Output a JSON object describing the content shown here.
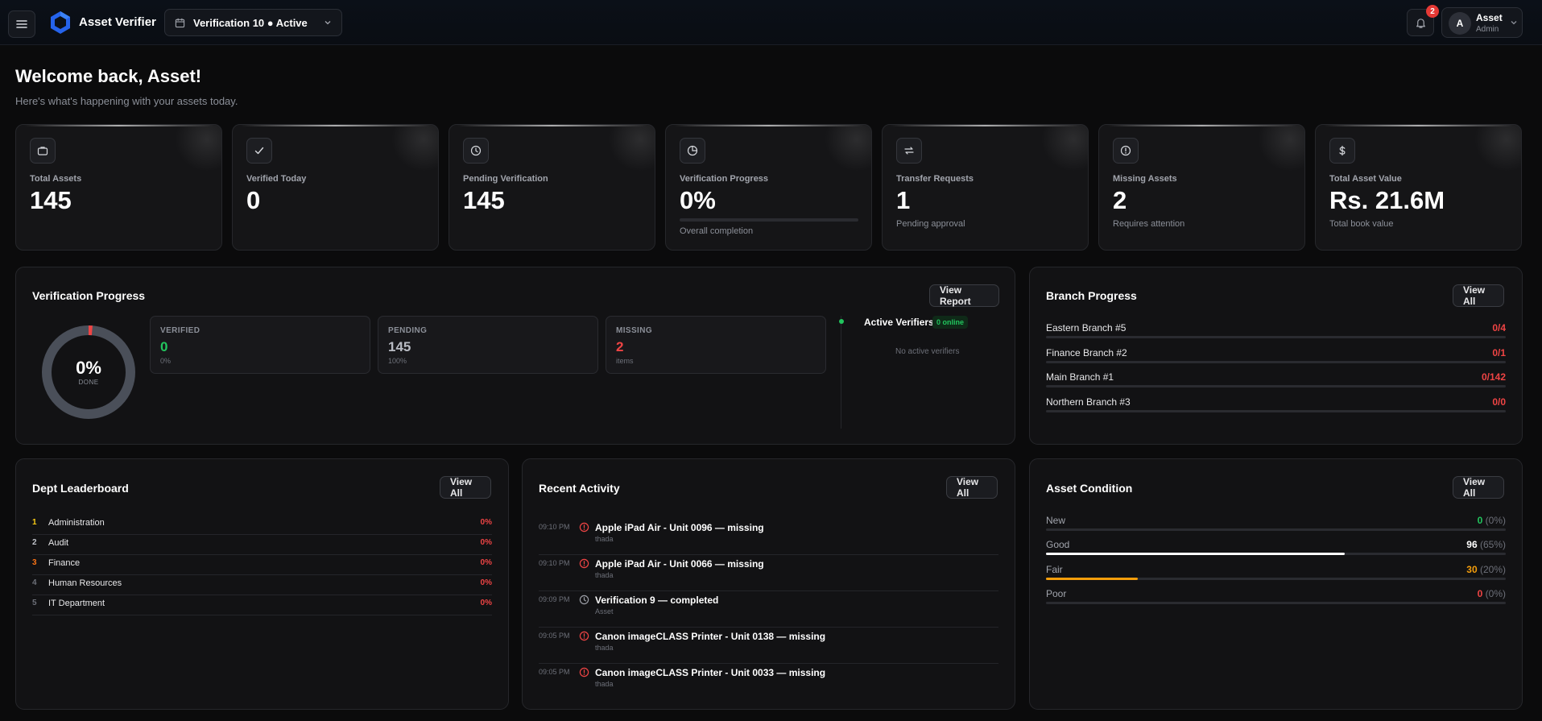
{
  "header": {
    "app_name": "Asset Verifier",
    "verification_selector": "Verification 10 ● Active",
    "notification_count": "2",
    "user": {
      "initial": "A",
      "name": "Asset",
      "role": "Admin"
    }
  },
  "welcome": {
    "title": "Welcome back, Asset!",
    "subtitle": "Here's what's happening with your assets today."
  },
  "stats": [
    {
      "icon": "briefcase-icon",
      "label": "Total Assets",
      "value": "145",
      "sub": ""
    },
    {
      "icon": "check-icon",
      "label": "Verified Today",
      "value": "0",
      "sub": ""
    },
    {
      "icon": "clock-icon",
      "label": "Pending Verification",
      "value": "145",
      "sub": ""
    },
    {
      "icon": "pie-chart-icon",
      "label": "Verification Progress",
      "value": "0%",
      "sub": "Overall completion",
      "progress": 0
    },
    {
      "icon": "transfer-icon",
      "label": "Transfer Requests",
      "value": "1",
      "sub": "Pending approval"
    },
    {
      "icon": "alert-circle-icon",
      "label": "Missing Assets",
      "value": "2",
      "sub": "Requires attention"
    },
    {
      "icon": "dollar-icon",
      "label": "Total Asset Value",
      "value": "Rs. 21.6M",
      "sub": "Total book value"
    }
  ],
  "verification_progress": {
    "title": "Verification Progress",
    "button": "View Report",
    "donut": {
      "percent_label": "0%",
      "caption": "DONE",
      "missing_fraction": 0.0138
    },
    "cards": [
      {
        "label": "VERIFIED",
        "value": "0",
        "sub": "0%",
        "color": "#22c55e"
      },
      {
        "label": "PENDING",
        "value": "145",
        "sub": "100%",
        "color": "#b8bbc3"
      },
      {
        "label": "MISSING",
        "value": "2",
        "sub": "items",
        "color": "#ef4444"
      }
    ],
    "active_verifiers": {
      "title": "Active Verifiers",
      "badge": "0 online",
      "empty": "No active verifiers"
    }
  },
  "branch_progress": {
    "title": "Branch Progress",
    "button": "View All",
    "rows": [
      {
        "name": "Eastern Branch #5",
        "value": "0/4",
        "progress": 0
      },
      {
        "name": "Finance Branch #2",
        "value": "0/1",
        "progress": 0
      },
      {
        "name": "Main Branch #1",
        "value": "0/142",
        "progress": 0
      },
      {
        "name": "Northern Branch #3",
        "value": "0/0",
        "progress": 0
      }
    ]
  },
  "leaderboard": {
    "title": "Dept Leaderboard",
    "button": "View All",
    "rows": [
      {
        "rank": "1",
        "dept": "Administration",
        "pct": "0%",
        "rank_color": "#facc15"
      },
      {
        "rank": "2",
        "dept": "Audit",
        "pct": "0%",
        "rank_color": "#c0c3ca"
      },
      {
        "rank": "3",
        "dept": "Finance",
        "pct": "0%",
        "rank_color": "#f97316"
      },
      {
        "rank": "4",
        "dept": "Human Resources",
        "pct": "0%",
        "rank_color": "#6d7079"
      },
      {
        "rank": "5",
        "dept": "IT Department",
        "pct": "0%",
        "rank_color": "#6d7079"
      }
    ]
  },
  "activity": {
    "title": "Recent Activity",
    "button": "View All",
    "rows": [
      {
        "time": "09:10 PM",
        "icon": "alert-circle-icon",
        "title": "Apple iPad Air - Unit 0096 — missing",
        "who": "thada",
        "icon_color": "#ef4444"
      },
      {
        "time": "09:10 PM",
        "icon": "alert-circle-icon",
        "title": "Apple iPad Air - Unit 0066 — missing",
        "who": "thada",
        "icon_color": "#ef4444"
      },
      {
        "time": "09:09 PM",
        "icon": "clock-icon",
        "title": "Verification 9 — completed",
        "who": "Asset",
        "icon_color": "#9a9da5"
      },
      {
        "time": "09:05 PM",
        "icon": "alert-circle-icon",
        "title": "Canon imageCLASS Printer - Unit 0138 — missing",
        "who": "thada",
        "icon_color": "#ef4444"
      },
      {
        "time": "09:05 PM",
        "icon": "alert-circle-icon",
        "title": "Canon imageCLASS Printer - Unit 0033 — missing",
        "who": "thada",
        "icon_color": "#ef4444"
      }
    ]
  },
  "asset_condition": {
    "title": "Asset Condition",
    "button": "View All",
    "rows": [
      {
        "name": "New",
        "count": "0",
        "pct": "(0%)",
        "progress": 0,
        "color": "#22c55e"
      },
      {
        "name": "Good",
        "count": "96",
        "pct": "(65%)",
        "progress": 0.65,
        "color": "#ffffff"
      },
      {
        "name": "Fair",
        "count": "30",
        "pct": "(20%)",
        "progress": 0.2,
        "color": "#f59e0b"
      },
      {
        "name": "Poor",
        "count": "0",
        "pct": "(0%)",
        "progress": 0,
        "color": "#ef4444"
      }
    ]
  }
}
